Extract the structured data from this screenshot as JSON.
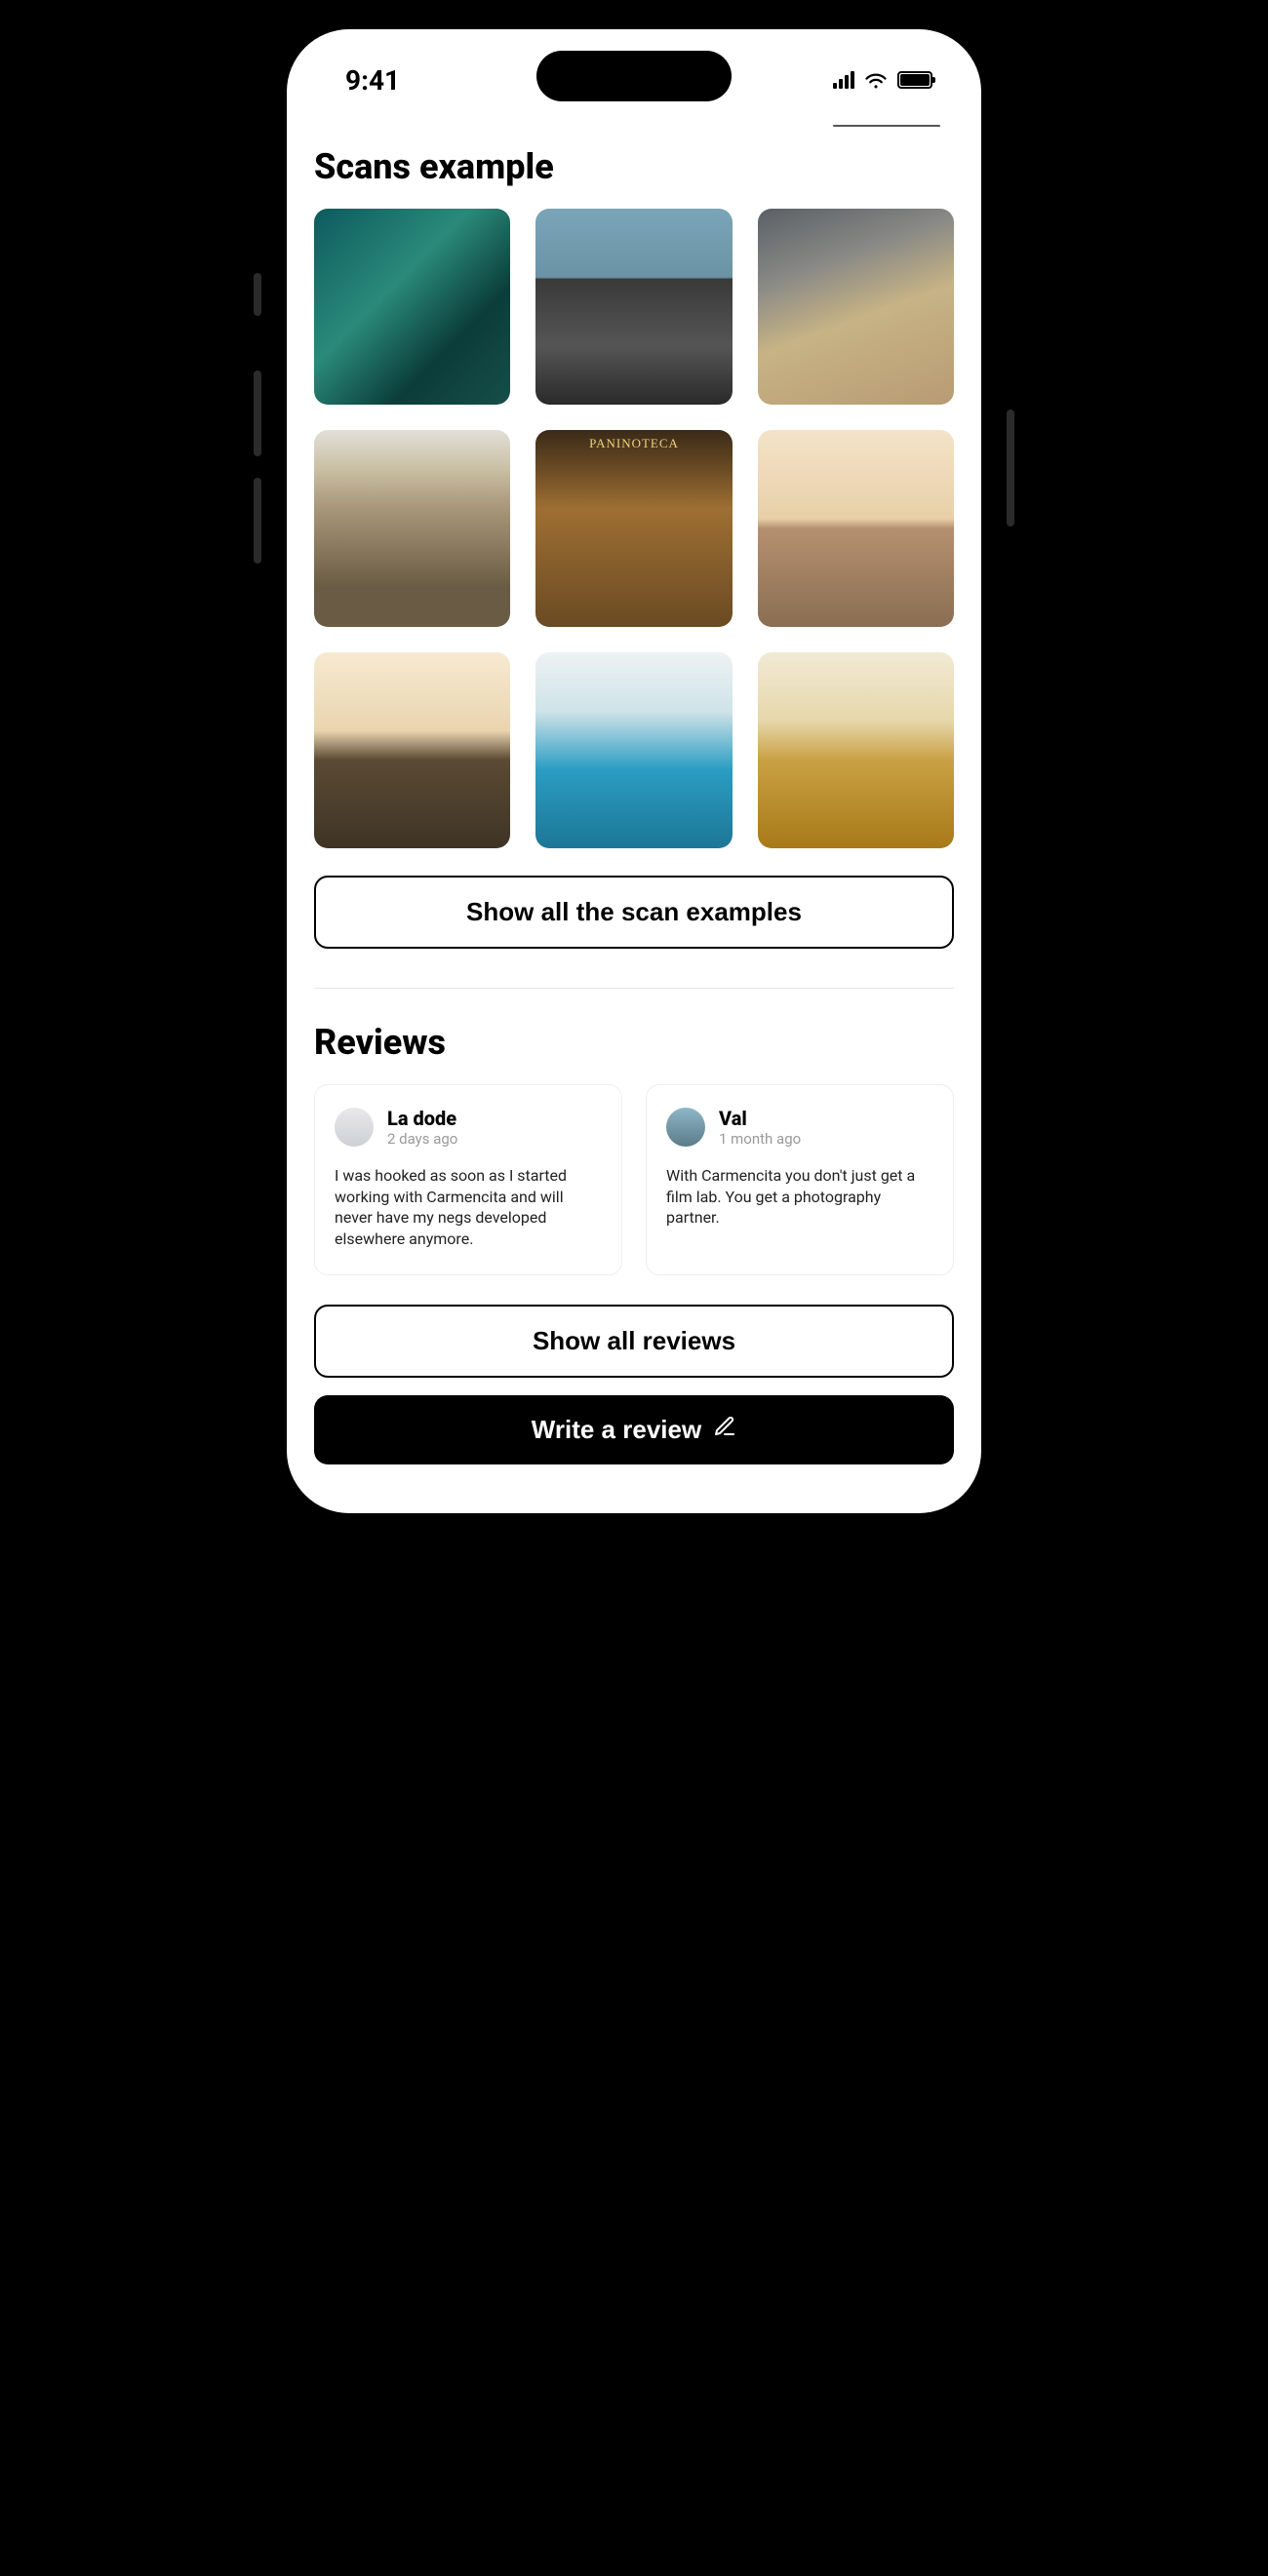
{
  "status": {
    "time": "9:41"
  },
  "scans": {
    "title": "Scans example",
    "show_all_label": "Show all the scan examples"
  },
  "reviews": {
    "title": "Reviews",
    "items": [
      {
        "name": "La dode",
        "time": "2 days ago",
        "body": "I was hooked as soon as I started working with Carmencita and will never have my negs developed elsewhere anymore."
      },
      {
        "name": "Val",
        "time": "1 month ago",
        "body": "With Carmencita you don't just get a film lab. You get a photography partner."
      }
    ],
    "show_all_label": "Show all reviews",
    "write_label": "Write a review"
  }
}
